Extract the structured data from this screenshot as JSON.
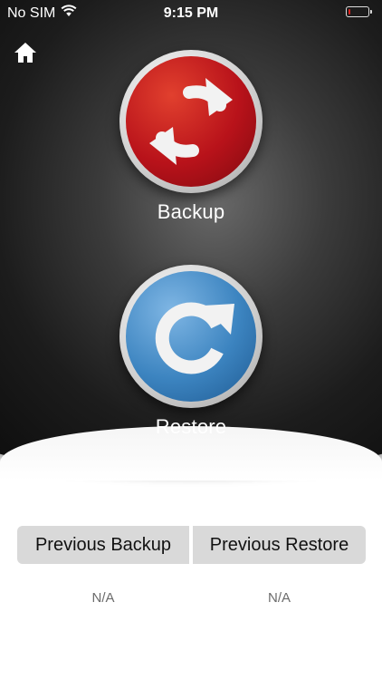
{
  "status_bar": {
    "carrier": "No SIM",
    "time": "9:15 PM",
    "battery_level": 0.08,
    "battery_color": "#e0211b"
  },
  "nav": {
    "home_icon": "home-icon"
  },
  "actions": {
    "backup": {
      "label": "Backup",
      "icon": "sync-arrows-icon",
      "color": "#b8121a"
    },
    "restore": {
      "label": "Restore",
      "icon": "refresh-icon",
      "color": "#3c84c0"
    }
  },
  "history": {
    "previous_backup_label": "Previous Backup",
    "previous_restore_label": "Previous Restore",
    "previous_backup_value": "N/A",
    "previous_restore_value": "N/A"
  }
}
